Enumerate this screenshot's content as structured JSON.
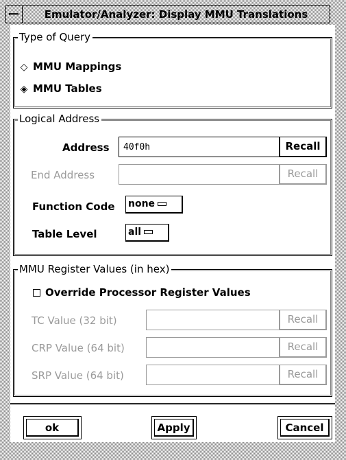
{
  "window": {
    "title": "Emulator/Analyzer: Display MMU Translations"
  },
  "query_group": {
    "legend": "Type of Query",
    "options": [
      {
        "label": "MMU Mappings",
        "selected": false
      },
      {
        "label": "MMU Tables",
        "selected": true
      }
    ]
  },
  "logical_group": {
    "legend": "Logical Address",
    "address_label": "Address",
    "address_value": "40f0h",
    "end_address_label": "End Address",
    "end_address_value": "",
    "recall_label": "Recall",
    "function_code_label": "Function Code",
    "function_code_value": "none",
    "table_level_label": "Table Level",
    "table_level_value": "all"
  },
  "register_group": {
    "legend": "MMU Register Values (in hex)",
    "override_label": "Override Processor Register Values",
    "override_checked": false,
    "tc_label": "TC Value (32 bit)",
    "crp_label": "CRP Value (64 bit)",
    "srp_label": "SRP Value (64 bit)",
    "recall_label": "Recall"
  },
  "actions": {
    "ok_label": "ok",
    "apply_label": "Apply",
    "cancel_label": "Cancel"
  }
}
